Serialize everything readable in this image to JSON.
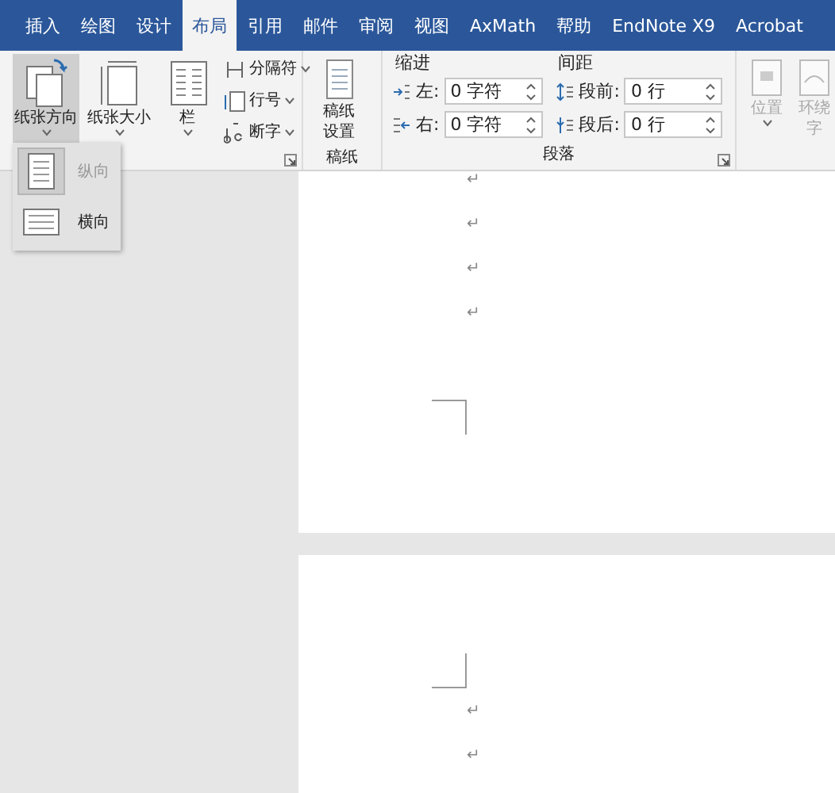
{
  "tabs": [
    {
      "label": "插入",
      "selected": false
    },
    {
      "label": "绘图",
      "selected": false
    },
    {
      "label": "设计",
      "selected": false
    },
    {
      "label": "布局",
      "selected": true
    },
    {
      "label": "引用",
      "selected": false
    },
    {
      "label": "邮件",
      "selected": false
    },
    {
      "label": "审阅",
      "selected": false
    },
    {
      "label": "视图",
      "selected": false
    },
    {
      "label": "AxMath",
      "selected": false
    },
    {
      "label": "帮助",
      "selected": false
    },
    {
      "label": "EndNote X9",
      "selected": false
    },
    {
      "label": "Acrobat",
      "selected": false
    }
  ],
  "page_setup": {
    "buttons": [
      {
        "label": "纸张方向",
        "kind": "orientation",
        "open": true
      },
      {
        "label": "纸张大小",
        "kind": "size",
        "open": false
      },
      {
        "label": "栏",
        "kind": "columns",
        "open": false
      }
    ],
    "commands": [
      {
        "label": "分隔符",
        "kind": "breaks"
      },
      {
        "label": "行号",
        "kind": "line-numbers"
      },
      {
        "label": "断字",
        "kind": "hyphenation"
      }
    ]
  },
  "manuscript": {
    "button": "稿纸设置",
    "group_label": "稿纸"
  },
  "paragraph": {
    "indent_title": "缩进",
    "spacing_title": "间距",
    "group_label": "段落",
    "indent": [
      {
        "label": "左:",
        "value": "0 字符"
      },
      {
        "label": "右:",
        "value": "0 字符"
      }
    ],
    "spacing": [
      {
        "label": "段前:",
        "value": "0 行"
      },
      {
        "label": "段后:",
        "value": "0 行"
      }
    ]
  },
  "arrange": {
    "buttons": [
      {
        "label": "位置",
        "disabled": true
      },
      {
        "label_lines": [
          "环绕",
          "字"
        ],
        "disabled": true
      }
    ]
  },
  "orientation_menu": [
    {
      "label": "纵向",
      "selected": true
    },
    {
      "label": "横向",
      "selected": false
    }
  ],
  "pages": [
    {
      "marks_before": [
        "↵",
        "↵",
        "↵",
        "↵"
      ]
    },
    {
      "marks_after": [
        "↵",
        "↵"
      ]
    }
  ]
}
